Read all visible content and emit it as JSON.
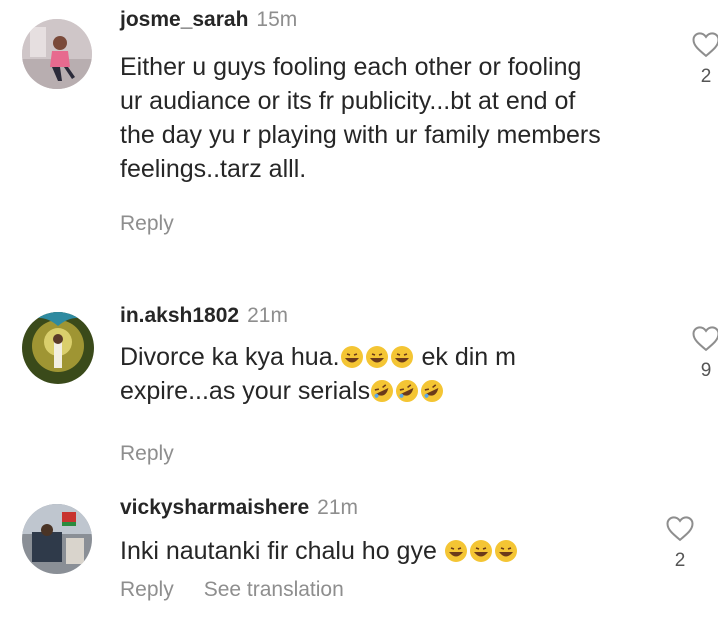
{
  "comments": [
    {
      "username": "josme_sarah",
      "time": "15m",
      "text": "Either u guys fooling each other or fooling\nur audiance or its fr publicity...bt at end of\nthe day yu r playing with ur family members\nfeelings..tarz alll.",
      "reply_label": "Reply",
      "likes": "2"
    },
    {
      "username": "in.aksh1802",
      "time": "21m",
      "text_part1": "Divorce ka kya hua.",
      "emojis1": [
        "grinning-sweat-emoji",
        "grinning-sweat-emoji",
        "grinning-sweat-emoji"
      ],
      "text_part2": " ek din m",
      "text_part3": "expire...as your serials",
      "emojis2": [
        "rolling-laughing-emoji",
        "rolling-laughing-emoji",
        "rolling-laughing-emoji"
      ],
      "reply_label": "Reply",
      "likes": "9"
    },
    {
      "username": "vickysharmaishere",
      "time": "21m",
      "text": "Inki nautanki fir chalu ho gye",
      "emojis": [
        "grinning-sweat-emoji",
        "grinning-sweat-emoji",
        "grinning-sweat-emoji"
      ],
      "reply_label": "Reply",
      "see_translation_label": "See translation",
      "likes": "2"
    }
  ],
  "colors": {
    "text": "#262626",
    "secondary": "#8e8e8e",
    "emoji": "#f4c534"
  }
}
